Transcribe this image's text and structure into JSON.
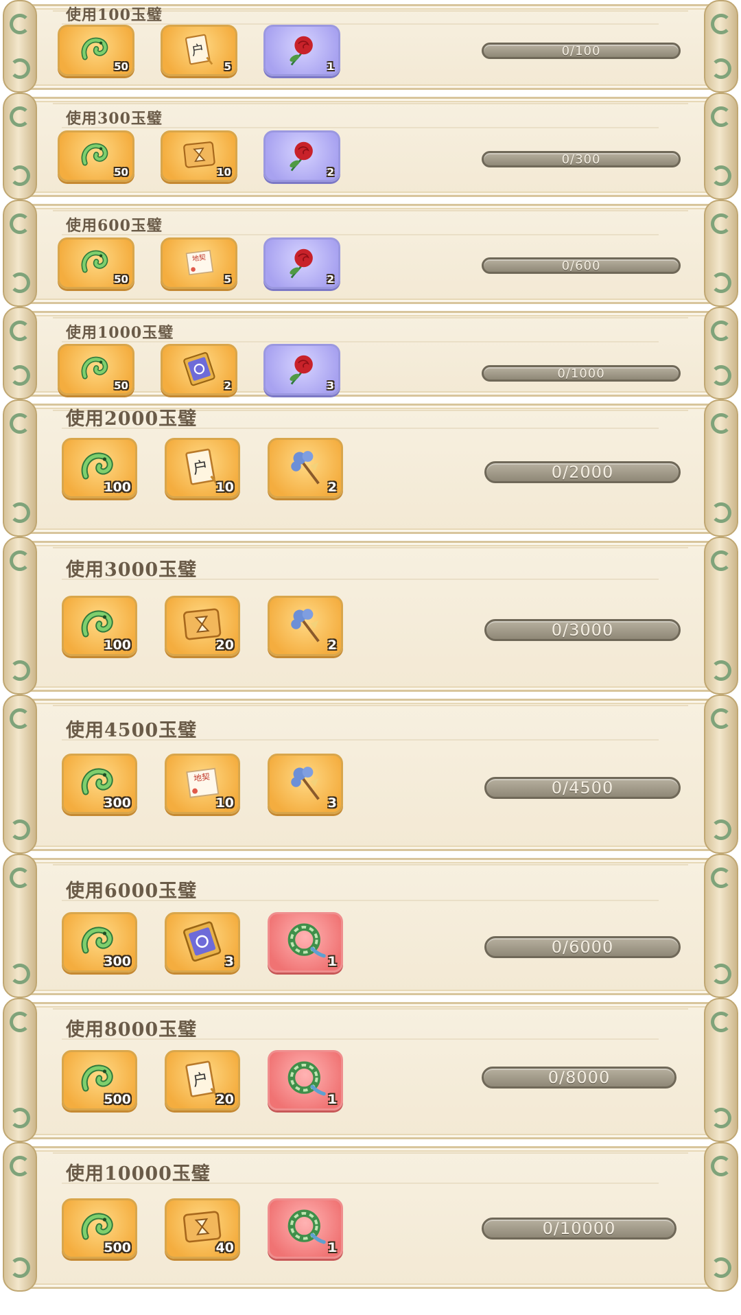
{
  "tiers": [
    {
      "title": "使用100玉璧",
      "progress": "0/100",
      "items": [
        {
          "icon": "jade-dragon-icon",
          "qty": "50",
          "frame": "gold"
        },
        {
          "icon": "household-book-icon",
          "qty": "5",
          "frame": "gold"
        },
        {
          "icon": "red-rose-icon",
          "qty": "1",
          "frame": "purple"
        }
      ]
    },
    {
      "title": "使用300玉璧",
      "progress": "0/300",
      "items": [
        {
          "icon": "jade-dragon-icon",
          "qty": "50",
          "frame": "gold"
        },
        {
          "icon": "hourglass-card-icon",
          "qty": "10",
          "frame": "gold"
        },
        {
          "icon": "red-rose-icon",
          "qty": "2",
          "frame": "purple"
        }
      ]
    },
    {
      "title": "使用600玉璧",
      "progress": "0/600",
      "items": [
        {
          "icon": "jade-dragon-icon",
          "qty": "50",
          "frame": "gold"
        },
        {
          "icon": "land-deed-scroll-icon",
          "qty": "5",
          "frame": "gold"
        },
        {
          "icon": "red-rose-icon",
          "qty": "2",
          "frame": "purple"
        }
      ]
    },
    {
      "title": "使用1000玉璧",
      "progress": "0/1000",
      "items": [
        {
          "icon": "jade-dragon-icon",
          "qty": "50",
          "frame": "gold"
        },
        {
          "icon": "portal-scroll-icon",
          "qty": "2",
          "frame": "gold"
        },
        {
          "icon": "red-rose-icon",
          "qty": "3",
          "frame": "purple"
        }
      ]
    },
    {
      "title": "使用2000玉璧",
      "progress": "0/2000",
      "items": [
        {
          "icon": "jade-dragon-icon",
          "qty": "100",
          "frame": "gold"
        },
        {
          "icon": "household-book-icon",
          "qty": "10",
          "frame": "gold"
        },
        {
          "icon": "blue-flower-branch-icon",
          "qty": "2",
          "frame": "gold"
        }
      ]
    },
    {
      "title": "使用3000玉璧",
      "progress": "0/3000",
      "items": [
        {
          "icon": "jade-dragon-icon",
          "qty": "100",
          "frame": "gold"
        },
        {
          "icon": "hourglass-card-icon",
          "qty": "20",
          "frame": "gold"
        },
        {
          "icon": "blue-flower-branch-icon",
          "qty": "2",
          "frame": "gold"
        }
      ]
    },
    {
      "title": "使用4500玉璧",
      "progress": "0/4500",
      "items": [
        {
          "icon": "jade-dragon-icon",
          "qty": "300",
          "frame": "gold"
        },
        {
          "icon": "land-deed-scroll-icon",
          "qty": "10",
          "frame": "gold"
        },
        {
          "icon": "blue-flower-branch-icon",
          "qty": "3",
          "frame": "gold"
        }
      ]
    },
    {
      "title": "使用6000玉璧",
      "progress": "0/6000",
      "items": [
        {
          "icon": "jade-dragon-icon",
          "qty": "300",
          "frame": "gold"
        },
        {
          "icon": "portal-scroll-icon",
          "qty": "3",
          "frame": "gold"
        },
        {
          "icon": "jade-ring-icon",
          "qty": "1",
          "frame": "pink"
        }
      ]
    },
    {
      "title": "使用8000玉璧",
      "progress": "0/8000",
      "items": [
        {
          "icon": "jade-dragon-icon",
          "qty": "500",
          "frame": "gold"
        },
        {
          "icon": "household-book-icon",
          "qty": "20",
          "frame": "gold"
        },
        {
          "icon": "jade-ring-icon",
          "qty": "1",
          "frame": "pink"
        }
      ]
    },
    {
      "title": "使用10000玉璧",
      "progress": "0/10000",
      "items": [
        {
          "icon": "jade-dragon-icon",
          "qty": "500",
          "frame": "gold"
        },
        {
          "icon": "hourglass-card-icon",
          "qty": "40",
          "frame": "gold"
        },
        {
          "icon": "jade-ring-icon",
          "qty": "1",
          "frame": "pink"
        }
      ]
    }
  ]
}
